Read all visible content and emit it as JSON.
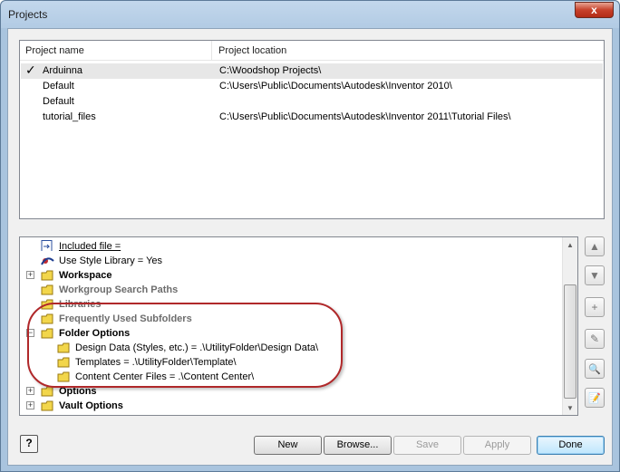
{
  "window": {
    "title": "Projects",
    "close_glyph": "x"
  },
  "project_list": {
    "columns": [
      "Project name",
      "Project location"
    ],
    "rows": [
      {
        "active_mark": "✓",
        "name": "Arduinna",
        "location": "C:\\Woodshop Projects\\"
      },
      {
        "active_mark": "",
        "name": "Default",
        "location": "C:\\Users\\Public\\Documents\\Autodesk\\Inventor 2010\\"
      },
      {
        "active_mark": "",
        "name": "Default",
        "location": ""
      },
      {
        "active_mark": "",
        "name": "tutorial_files",
        "location": "C:\\Users\\Public\\Documents\\Autodesk\\Inventor 2011\\Tutorial Files\\"
      }
    ]
  },
  "tree": {
    "included_file": "Included file =",
    "use_style_library": "Use Style Library = Yes",
    "workspace": "Workspace",
    "workgroup_search_paths": "Workgroup Search Paths",
    "libraries": "Libraries",
    "frequently_used_subfolders": "Frequently Used Subfolders",
    "folder_options": "Folder Options",
    "design_data": "Design Data (Styles, etc.) = .\\UtilityFolder\\Design Data\\",
    "templates": "Templates = .\\UtilityFolder\\Template\\",
    "content_center_files": "Content Center Files = .\\Content Center\\",
    "options": "Options",
    "vault_options": "Vault Options",
    "expand_glyph": "+",
    "collapse_glyph": "−"
  },
  "side_buttons": [
    {
      "icon": "move-up-icon",
      "glyph": "▲"
    },
    {
      "icon": "move-down-icon",
      "glyph": "▼"
    },
    {
      "icon": "add-icon",
      "glyph": "+"
    },
    {
      "icon": "edit-icon",
      "glyph": "✎"
    },
    {
      "icon": "find-icon",
      "glyph": "🔍"
    },
    {
      "icon": "edit-text-icon",
      "glyph": "📝"
    }
  ],
  "buttons": {
    "help": "?",
    "new": "New",
    "browse": "Browse...",
    "save": "Save",
    "apply": "Apply",
    "done": "Done"
  },
  "colors": {
    "highlight_oval": "#b0282a",
    "folder": "#f2d64b"
  }
}
